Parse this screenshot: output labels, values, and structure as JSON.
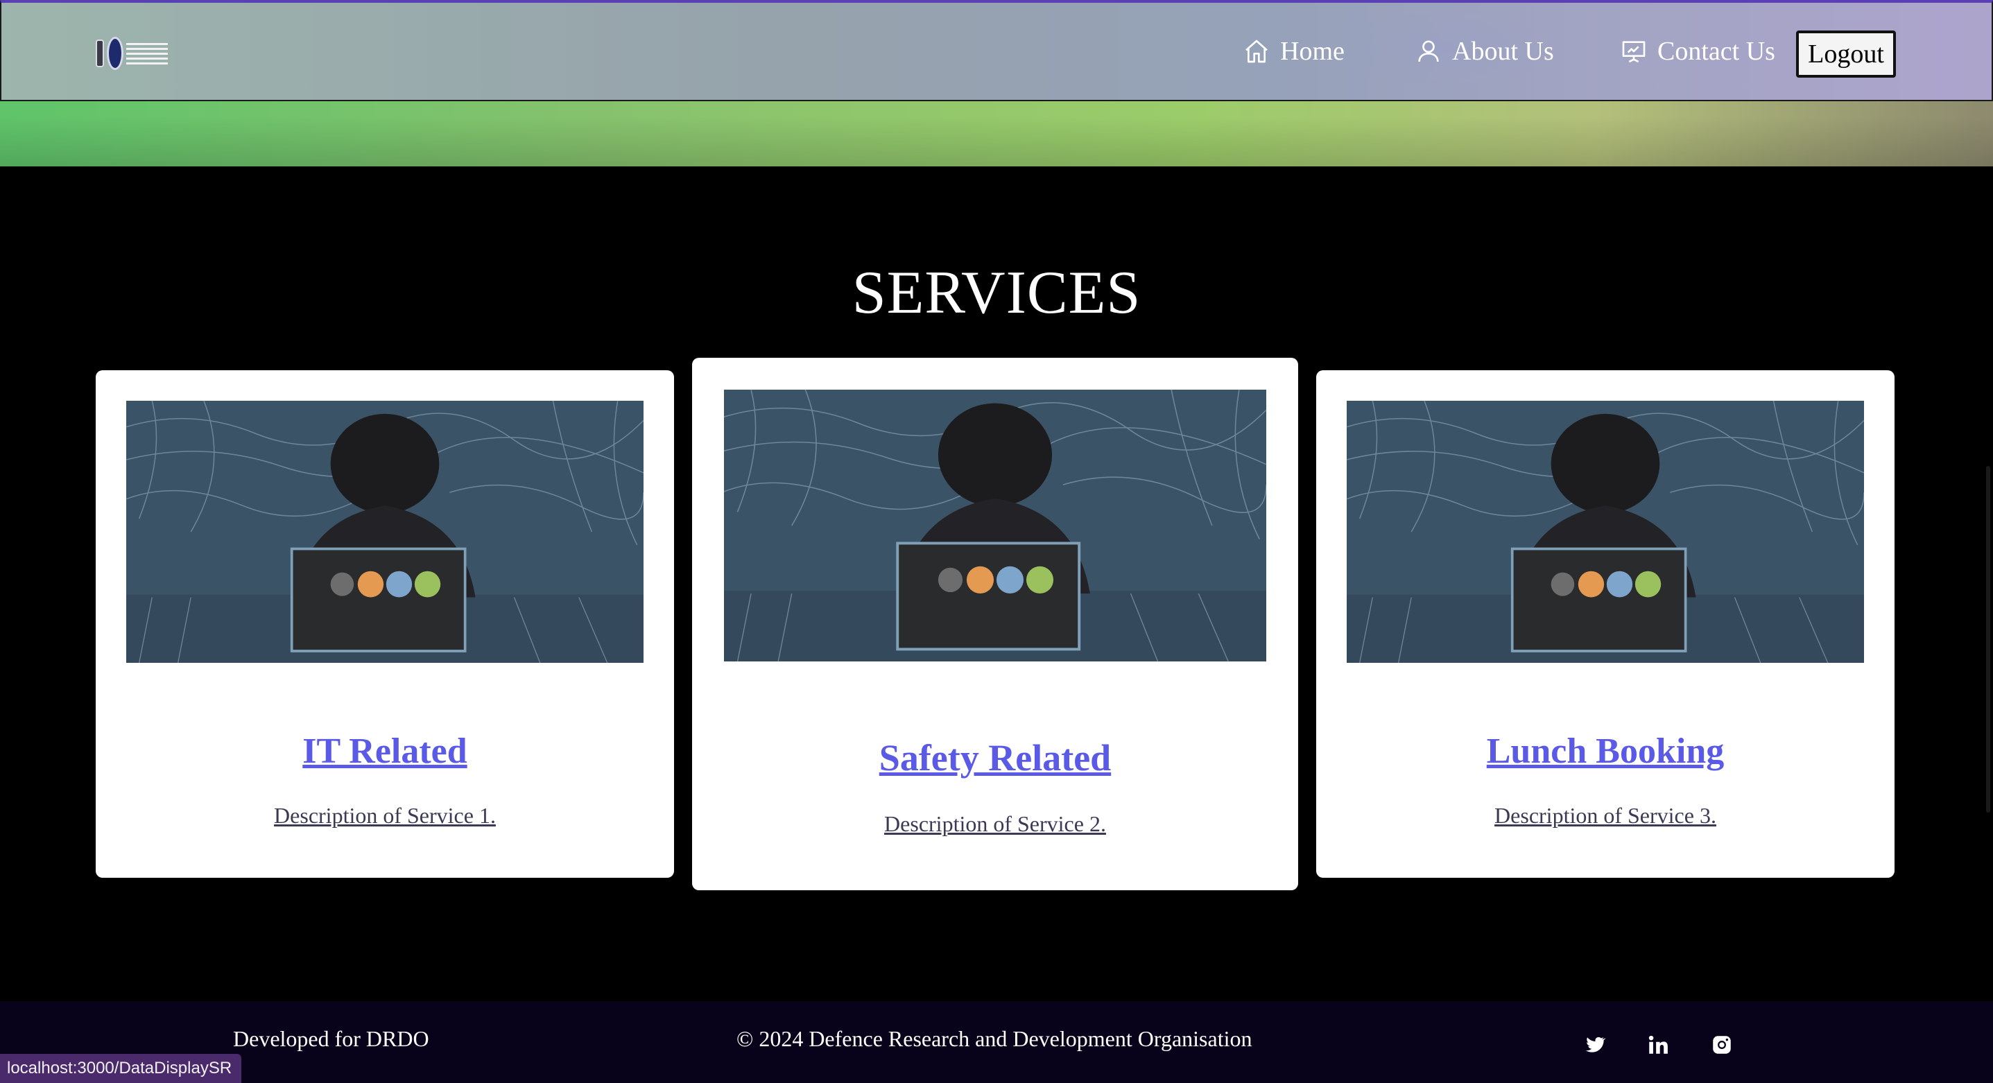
{
  "header": {
    "nav": [
      {
        "label": "Home",
        "icon": "home-icon"
      },
      {
        "label": "About Us",
        "icon": "user-icon"
      },
      {
        "label": "Contact Us",
        "icon": "presentation-icon"
      }
    ],
    "logout_label": "Logout"
  },
  "services": {
    "title": "SERVICES",
    "cards": [
      {
        "title": "IT Related",
        "description": "Description of Service 1."
      },
      {
        "title": "Safety Related",
        "description": "Description of Service 2."
      },
      {
        "title": "Lunch Booking",
        "description": "Description of Service 3."
      }
    ]
  },
  "footer": {
    "developed": "Developed for DRDO",
    "copyright": "© 2024 Defence Research and Development Organisation",
    "social": [
      "twitter-icon",
      "linkedin-icon",
      "instagram-icon"
    ]
  },
  "status_url": "localhost:3000/DataDisplaySR",
  "colors": {
    "link": "#5a5ae6",
    "footer_bg": "#08031a",
    "header_border_top": "#5b3fb5"
  }
}
